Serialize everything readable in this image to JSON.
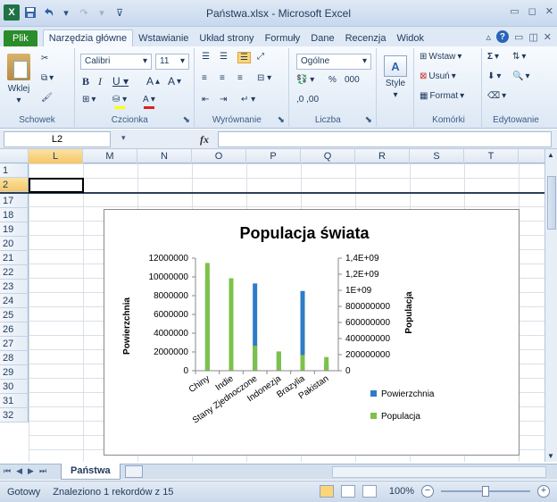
{
  "window": {
    "title": "Państwa.xlsx - Microsoft Excel",
    "app_icon": "X",
    "colors": {
      "file_tab": "#2a8c2a",
      "accent": "#2a63b8"
    }
  },
  "ribbon_tabs": [
    "Plik",
    "Narzędzia główne",
    "Wstawianie",
    "Układ strony",
    "Formuły",
    "Dane",
    "Recenzja",
    "Widok"
  ],
  "ribbon": {
    "clipboard": {
      "paste": "Wklej",
      "label": "Schowek"
    },
    "font": {
      "name": "Calibri",
      "size": "11",
      "label": "Czcionka"
    },
    "alignment": {
      "label": "Wyrównanie"
    },
    "number": {
      "format": "Ogólne",
      "percent": "%",
      "thousands": "000",
      "dec_inc": ",0 ,00",
      "label": "Liczba"
    },
    "styles": {
      "label": "Style"
    },
    "cells": {
      "insert": "Wstaw",
      "delete": "Usuń",
      "format": "Format",
      "label": "Komórki"
    },
    "editing": {
      "label": "Edytowanie"
    }
  },
  "formula_bar": {
    "name_box": "L2",
    "fx": "fx",
    "content": ""
  },
  "columns": [
    "L",
    "M",
    "N",
    "O",
    "P",
    "Q",
    "R",
    "S",
    "T"
  ],
  "rows": [
    "1",
    "2",
    "17",
    "18",
    "19",
    "20",
    "21",
    "22",
    "23",
    "24",
    "25",
    "26",
    "27",
    "28",
    "29",
    "30",
    "31",
    "32"
  ],
  "chart_data": {
    "type": "bar",
    "title": "Populacja świata",
    "categories": [
      "Chiny",
      "Indie",
      "Stany Zjednoczone",
      "Indonezja",
      "Brazylia",
      "Pakistan"
    ],
    "series": [
      {
        "name": "Powierzchnia",
        "axis": "left",
        "color": "#2e7cc7",
        "values": [
          9600000,
          3300000,
          9300000,
          1900000,
          8500000,
          800000
        ]
      },
      {
        "name": "Populacja",
        "axis": "right",
        "color": "#7cc24a",
        "values": [
          1340000000,
          1150000000,
          310000000,
          240000000,
          195000000,
          170000000
        ]
      }
    ],
    "ylabel_left": "Powierzchnia",
    "ylabel_right": "Populacja",
    "ylim_left": [
      0,
      12000000
    ],
    "ylim_right": [
      0,
      1400000000
    ],
    "yticks_left": [
      "0",
      "2000000",
      "4000000",
      "6000000",
      "8000000",
      "10000000",
      "12000000"
    ],
    "yticks_right": [
      "0",
      "200000000",
      "400000000",
      "600000000",
      "800000000",
      "1E+09",
      "1,2E+09",
      "1,4E+09"
    ],
    "legend_position": "right"
  },
  "sheet_tabs": [
    "Państwa"
  ],
  "status": {
    "ready": "Gotowy",
    "message": "Znaleziono 1 rekordów z 15",
    "zoom": "100%",
    "zoom_fraction": 0.5
  }
}
